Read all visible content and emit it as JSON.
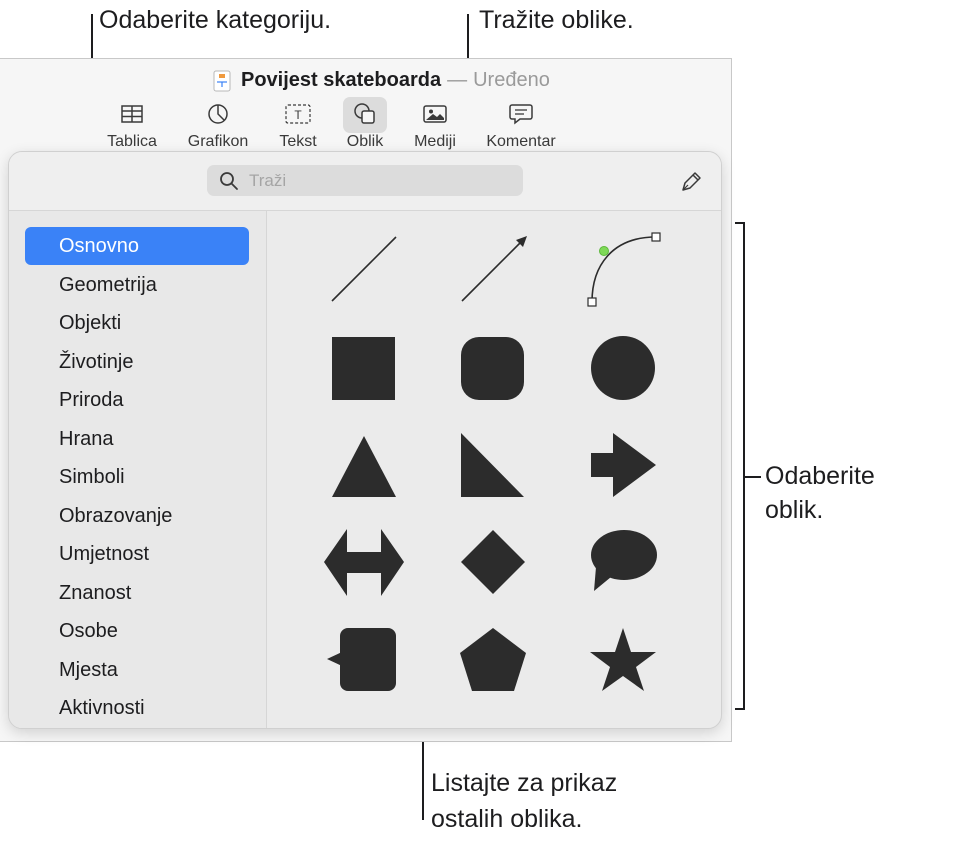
{
  "callouts": {
    "choose_category": "Odaberite kategoriju.",
    "search_shapes": "Tražite oblike.",
    "choose_shape_line1": "Odaberite",
    "choose_shape_line2": "oblik.",
    "scroll_line1": "Listajte za prikaz",
    "scroll_line2": "ostalih oblika."
  },
  "window": {
    "doc_title": "Povijest skateboarda",
    "separator": "—",
    "doc_state": "Uređeno"
  },
  "toolbar": [
    {
      "label": "Tablica",
      "icon": "table-icon"
    },
    {
      "label": "Grafikon",
      "icon": "chart-icon"
    },
    {
      "label": "Tekst",
      "icon": "text-box-icon"
    },
    {
      "label": "Oblik",
      "icon": "shape-icon"
    },
    {
      "label": "Mediji",
      "icon": "media-icon"
    },
    {
      "label": "Komentar",
      "icon": "comment-icon"
    }
  ],
  "search": {
    "placeholder": "Traži"
  },
  "categories": [
    "Osnovno",
    "Geometrija",
    "Objekti",
    "Životinje",
    "Priroda",
    "Hrana",
    "Simboli",
    "Obrazovanje",
    "Umjetnost",
    "Znanost",
    "Osobe",
    "Mjesta",
    "Aktivnosti"
  ],
  "selected_category": "Osnovno",
  "shapes": [
    "line",
    "arrow-line",
    "curve",
    "square",
    "rounded-square",
    "circle",
    "triangle",
    "right-triangle",
    "arrow",
    "double-arrow",
    "diamond",
    "speech-bubble",
    "callout-square",
    "pentagon",
    "star"
  ],
  "colors": {
    "accent": "#3a82f7",
    "shape_fill": "#2c2c2c",
    "curve_point": "#7ed957"
  }
}
